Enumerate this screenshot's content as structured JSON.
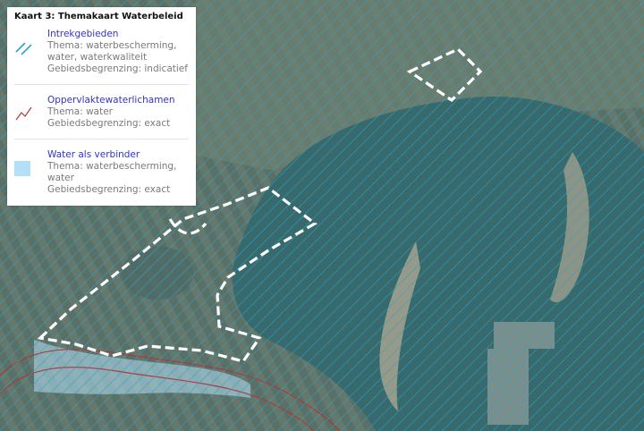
{
  "map": {
    "title": "Kaart 3: Themakaart Waterbeleid"
  },
  "legend": {
    "entries": [
      {
        "name": "Intrekgebieden",
        "thema": "Thema: waterbescherming, water, waterkwaliteit",
        "begrenzing": "Gebiedsbegrenzing: indicatief",
        "icon": "hatch-icon",
        "color": "#2aa6c4"
      },
      {
        "name": "Oppervlaktewaterlichamen",
        "thema": "Thema: water",
        "begrenzing": "Gebiedsbegrenzing: exact",
        "icon": "water-line-icon",
        "color": "#b0383a"
      },
      {
        "name": "Water als verbinder",
        "thema": "Thema: waterbescherming, water",
        "begrenzing": "Gebiedsbegrenzing: exact",
        "icon": "water-area-icon",
        "color": "#b3e0f7"
      }
    ]
  }
}
